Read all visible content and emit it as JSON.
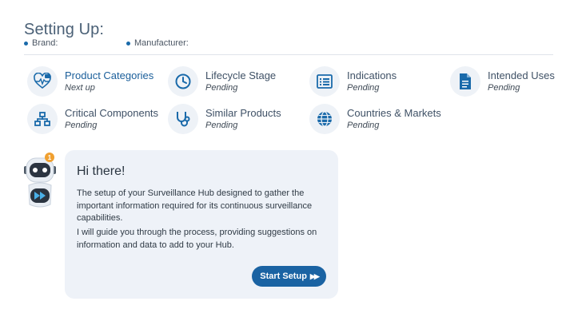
{
  "header": {
    "title": "Setting Up:",
    "brand_label": "Brand:",
    "manufacturer_label": "Manufacturer:"
  },
  "steps": [
    {
      "label": "Product Categories",
      "status": "Next up",
      "icon": "medical-categories-icon",
      "active": true
    },
    {
      "label": "Lifecycle Stage",
      "status": "Pending",
      "icon": "clock-icon"
    },
    {
      "label": "Indications",
      "status": "Pending",
      "icon": "list-icon"
    },
    {
      "label": "Intended Uses",
      "status": "Pending",
      "icon": "document-icon"
    },
    {
      "label": "Critical Components",
      "status": "Pending",
      "icon": "network-icon"
    },
    {
      "label": "Similar Products",
      "status": "Pending",
      "icon": "stethoscope-icon"
    },
    {
      "label": "Countries & Markets",
      "status": "Pending",
      "icon": "globe-icon"
    }
  ],
  "assistant": {
    "badge_count": "1",
    "greeting": "Hi there!",
    "paragraph_1": "The setup of your Surveillance Hub designed to gather the important information required for its continuous surveillance capabilities.",
    "paragraph_2": "I will guide you through the process, providing suggestions on information and data to add to your Hub.",
    "start_button_label": "Start Setup",
    "start_button_icon": "fast-forward-icon"
  },
  "colors": {
    "accent": "#1a63a3",
    "icon_circle": "#eef2f7",
    "card_bg": "#eef2f8",
    "badge": "#f0a030"
  }
}
